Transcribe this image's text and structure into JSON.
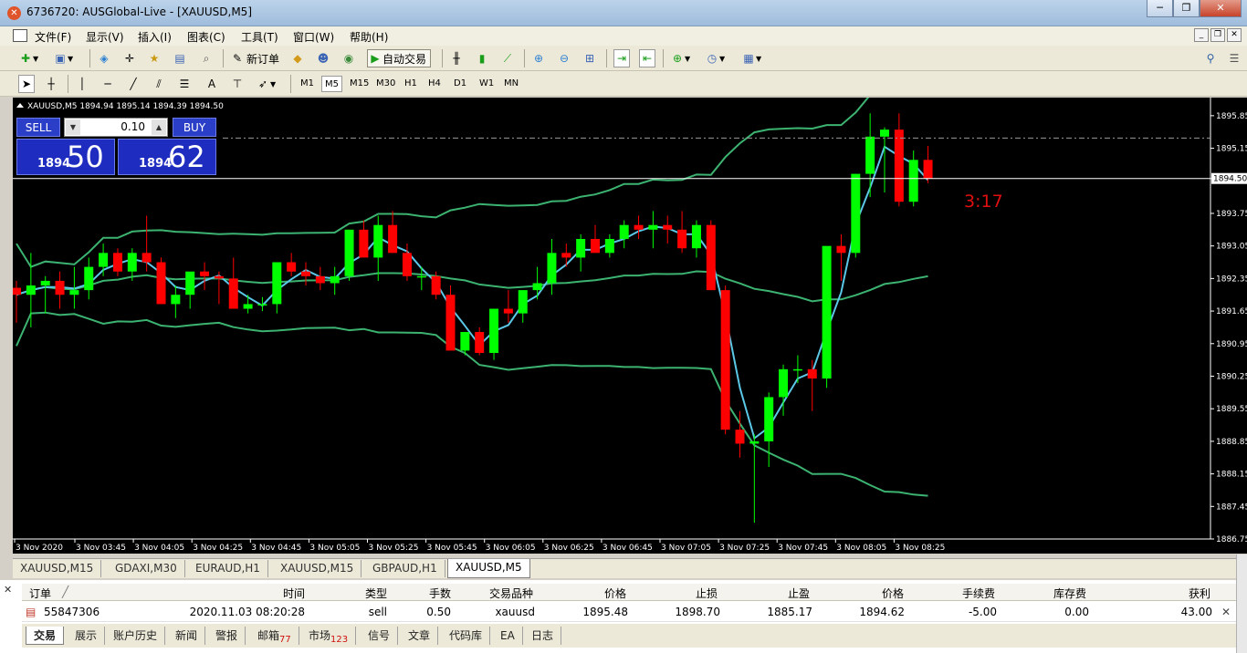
{
  "window": {
    "title": "6736720: AUSGlobal-Live - [XAUUSD,M5]"
  },
  "menu": [
    "文件(F)",
    "显示(V)",
    "插入(I)",
    "图表(C)",
    "工具(T)",
    "窗口(W)",
    "帮助(H)"
  ],
  "toolbar": {
    "new_order": "新订单",
    "auto_trade": "自动交易"
  },
  "timeframes": [
    "M1",
    "M5",
    "M15",
    "M30",
    "H1",
    "H4",
    "D1",
    "W1",
    "MN"
  ],
  "text_tool": "A",
  "chart": {
    "header": "XAUUSD,M5  1894.94 1895.14 1894.39 1894.50",
    "countdown": "3:17",
    "current_price_label": "1894.50",
    "colors": {
      "bull": "#00ff00",
      "bear": "#ff0000",
      "bands": "#3cb371",
      "ma": "#5bc8e8",
      "bg": "#000000"
    },
    "trade_panel": {
      "sell_label": "SELL",
      "buy_label": "BUY",
      "lot": "0.10",
      "sell_small": "1894",
      "sell_big": "50",
      "buy_small": "1894",
      "buy_big": "62"
    }
  },
  "chart_data": {
    "type": "candlestick",
    "yaxis_ticks": [
      "1895.85",
      "1895.15",
      "1894.50",
      "1893.75",
      "1893.05",
      "1892.35",
      "1891.65",
      "1890.95",
      "1890.25",
      "1889.55",
      "1888.85",
      "1888.15",
      "1887.45",
      "1886.75"
    ],
    "xaxis_ticks": [
      "3 Nov 2020",
      "3 Nov 03:45",
      "3 Nov 04:05",
      "3 Nov 04:25",
      "3 Nov 04:45",
      "3 Nov 05:05",
      "3 Nov 05:25",
      "3 Nov 05:45",
      "3 Nov 06:05",
      "3 Nov 06:25",
      "3 Nov 06:45",
      "3 Nov 07:05",
      "3 Nov 07:25",
      "3 Nov 07:45",
      "3 Nov 08:05",
      "3 Nov 08:25"
    ],
    "ylim": [
      1886.75,
      1896.2
    ],
    "candles": [
      [
        1892.15,
        1892.3,
        1891.4,
        1892.0
      ],
      [
        1892.0,
        1892.9,
        1891.3,
        1892.2
      ],
      [
        1892.2,
        1892.4,
        1891.6,
        1892.3
      ],
      [
        1892.3,
        1892.5,
        1891.7,
        1892.0
      ],
      [
        1892.0,
        1892.6,
        1891.7,
        1892.1
      ],
      [
        1892.1,
        1892.8,
        1891.9,
        1892.6
      ],
      [
        1892.6,
        1893.1,
        1892.4,
        1892.9
      ],
      [
        1892.9,
        1893.0,
        1892.4,
        1892.5
      ],
      [
        1892.5,
        1893.0,
        1892.3,
        1892.9
      ],
      [
        1892.9,
        1893.7,
        1892.5,
        1892.7
      ],
      [
        1892.7,
        1892.8,
        1892.1,
        1891.8
      ],
      [
        1891.8,
        1892.2,
        1891.5,
        1892.0
      ],
      [
        1892.0,
        1892.4,
        1891.7,
        1892.5
      ],
      [
        1892.5,
        1892.7,
        1892.1,
        1892.4
      ],
      [
        1892.4,
        1892.5,
        1891.8,
        1892.35
      ],
      [
        1892.35,
        1892.8,
        1892.0,
        1891.7
      ],
      [
        1891.7,
        1892.0,
        1891.6,
        1891.8
      ],
      [
        1891.8,
        1891.95,
        1891.65,
        1891.8
      ],
      [
        1891.8,
        1892.7,
        1891.6,
        1892.7
      ],
      [
        1892.7,
        1892.9,
        1892.4,
        1892.5
      ],
      [
        1892.5,
        1892.7,
        1892.2,
        1892.4
      ],
      [
        1892.4,
        1892.6,
        1892.1,
        1892.25
      ],
      [
        1892.25,
        1892.6,
        1892.0,
        1892.4
      ],
      [
        1892.4,
        1893.4,
        1892.3,
        1893.4
      ],
      [
        1893.4,
        1893.6,
        1892.9,
        1892.8
      ],
      [
        1892.8,
        1893.7,
        1892.3,
        1893.5
      ],
      [
        1893.5,
        1893.8,
        1892.9,
        1892.9
      ],
      [
        1892.9,
        1893.1,
        1892.3,
        1892.4
      ],
      [
        1892.4,
        1892.6,
        1892.1,
        1892.4
      ],
      [
        1892.4,
        1892.5,
        1891.9,
        1892.0
      ],
      [
        1892.0,
        1892.2,
        1890.9,
        1890.8
      ],
      [
        1890.8,
        1891.2,
        1890.7,
        1891.2
      ],
      [
        1891.2,
        1891.3,
        1890.7,
        1890.75
      ],
      [
        1890.75,
        1891.7,
        1890.6,
        1891.7
      ],
      [
        1891.7,
        1892.1,
        1891.4,
        1891.6
      ],
      [
        1891.6,
        1892.1,
        1891.4,
        1892.1
      ],
      [
        1892.1,
        1892.6,
        1891.9,
        1892.25
      ],
      [
        1892.25,
        1893.2,
        1892.0,
        1892.9
      ],
      [
        1892.9,
        1893.1,
        1892.6,
        1892.8
      ],
      [
        1892.8,
        1893.3,
        1892.5,
        1893.2
      ],
      [
        1893.2,
        1893.5,
        1893.0,
        1892.9
      ],
      [
        1892.9,
        1893.3,
        1892.8,
        1893.2
      ],
      [
        1893.2,
        1893.6,
        1893.0,
        1893.5
      ],
      [
        1893.5,
        1893.7,
        1893.2,
        1893.4
      ],
      [
        1893.4,
        1893.8,
        1893.0,
        1893.5
      ],
      [
        1893.5,
        1893.7,
        1893.1,
        1893.4
      ],
      [
        1893.4,
        1893.8,
        1892.9,
        1893.0
      ],
      [
        1893.0,
        1893.6,
        1892.8,
        1893.5
      ],
      [
        1893.5,
        1893.6,
        1892.3,
        1892.1
      ],
      [
        1892.1,
        1892.2,
        1889.0,
        1889.1
      ],
      [
        1889.1,
        1889.5,
        1888.5,
        1888.8
      ],
      [
        1888.8,
        1889.0,
        1887.1,
        1888.85
      ],
      [
        1888.85,
        1889.9,
        1888.3,
        1889.8
      ],
      [
        1889.8,
        1890.5,
        1889.4,
        1890.4
      ],
      [
        1890.4,
        1890.7,
        1890.1,
        1890.4
      ],
      [
        1890.4,
        1890.6,
        1889.5,
        1890.2
      ],
      [
        1890.2,
        1893.0,
        1890.0,
        1893.05
      ],
      [
        1893.05,
        1893.3,
        1892.3,
        1892.9
      ],
      [
        1892.9,
        1894.6,
        1892.8,
        1894.6
      ],
      [
        1894.6,
        1895.9,
        1894.1,
        1895.4
      ],
      [
        1895.4,
        1895.6,
        1894.2,
        1895.55
      ],
      [
        1895.55,
        1895.9,
        1893.9,
        1894.0
      ],
      [
        1894.0,
        1895.1,
        1893.9,
        1894.9
      ],
      [
        1894.9,
        1895.2,
        1894.4,
        1894.5
      ]
    ]
  },
  "chart_tabs": [
    "XAUUSD,M15",
    "GDAXI,M30",
    "EURAUD,H1",
    "XAUUSD,M15",
    "GBPAUD,H1",
    "XAUUSD,M5"
  ],
  "terminal": {
    "headers": [
      "订单",
      "时间",
      "类型",
      "手数",
      "交易品种",
      "价格",
      "止损",
      "止盈",
      "价格",
      "手续费",
      "库存费",
      "获利"
    ],
    "row": [
      "55847306",
      "2020.11.03 08:20:28",
      "sell",
      "0.50",
      "xauusd",
      "1895.48",
      "1898.70",
      "1885.17",
      "1894.62",
      "-5.00",
      "0.00",
      "43.00"
    ],
    "tabs": [
      {
        "label": "交易"
      },
      {
        "label": "展示"
      },
      {
        "label": "账户历史"
      },
      {
        "label": "新闻"
      },
      {
        "label": "警报"
      },
      {
        "label": "邮箱",
        "badge": "77"
      },
      {
        "label": "市场",
        "badge": "123"
      },
      {
        "label": "信号"
      },
      {
        "label": "文章"
      },
      {
        "label": "代码库"
      },
      {
        "label": "EA"
      },
      {
        "label": "日志"
      }
    ]
  }
}
